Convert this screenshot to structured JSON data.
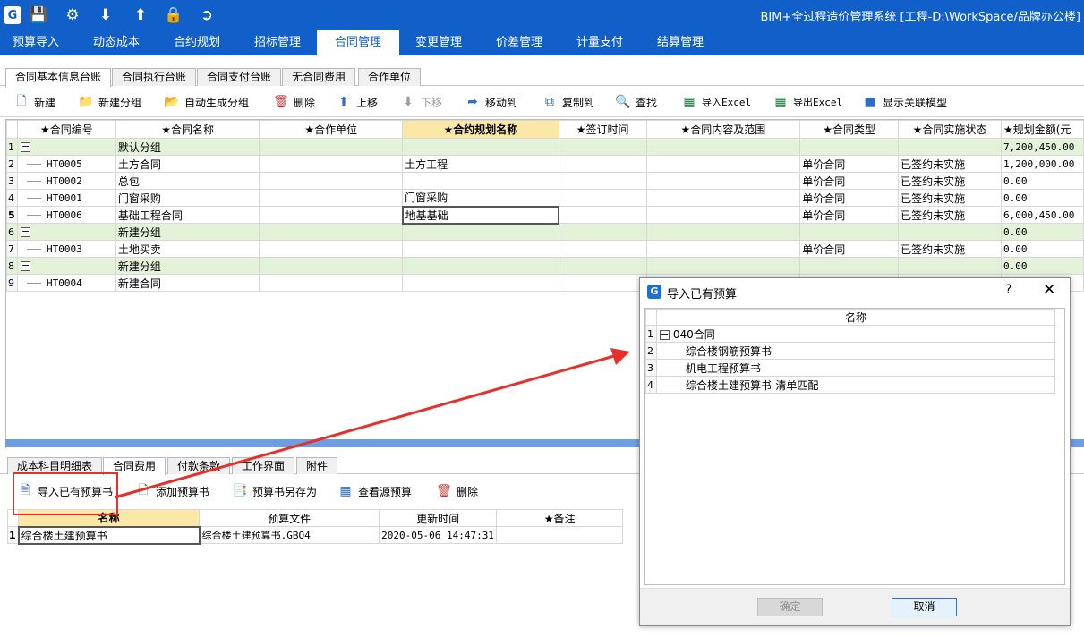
{
  "window": {
    "title": "BIM+全过程造价管理系统 [工程-D:\\WorkSpace/品牌办公楼]"
  },
  "quick_access": [
    "app-logo-icon",
    "save-icon",
    "settings-icon",
    "download-icon",
    "upload-icon",
    "lock-icon",
    "exit-icon"
  ],
  "menu": [
    "预算导入",
    "动态成本",
    "合约规划",
    "招标管理",
    "合同管理",
    "变更管理",
    "价差管理",
    "计量支付",
    "结算管理"
  ],
  "menu_active": "合同管理",
  "sub_tabs": [
    "合同基本信息台账",
    "合同执行台账",
    "合同支付台账",
    "无合同费用",
    "合作单位"
  ],
  "toolbar": {
    "new": "新建",
    "new_group": "新建分组",
    "auto_group": "自动生成分组",
    "delete": "删除",
    "move_up": "上移",
    "move_down": "下移",
    "move_to": "移动到",
    "copy_to": "复制到",
    "find": "查找",
    "import_excel": "导入Excel",
    "export_excel": "导出Excel",
    "show_model": "显示关联模型"
  },
  "grid": {
    "columns": [
      "★合同编号",
      "★合同名称",
      "★合作单位",
      "★合约规划名称",
      "★签订时间",
      "★合同内容及范围",
      "★合同类型",
      "★合同实施状态",
      "★规划金额(元"
    ],
    "rows": [
      {
        "n": "1",
        "type": "group",
        "toggle": "−",
        "name": "默认分组",
        "amount": "7,200,450.00"
      },
      {
        "n": "2",
        "code": "HT0005",
        "name": "土方合同",
        "plan": "土方工程",
        "ctype": "单价合同",
        "status": "已签约未实施",
        "amount": "1,200,000.00"
      },
      {
        "n": "3",
        "code": "HT0002",
        "name": "总包",
        "ctype": "单价合同",
        "status": "已签约未实施",
        "amount": "0.00"
      },
      {
        "n": "4",
        "code": "HT0001",
        "name": "门窗采购",
        "plan": "门窗采购",
        "ctype": "单价合同",
        "status": "已签约未实施",
        "amount": "0.00"
      },
      {
        "n": "5",
        "code": "HT0006",
        "name": "基础工程合同",
        "plan": "地基基础",
        "ctype": "单价合同",
        "status": "已签约未实施",
        "amount": "6,000,450.00"
      },
      {
        "n": "6",
        "type": "group",
        "toggle": "−",
        "name": "新建分组",
        "amount": "0.00"
      },
      {
        "n": "7",
        "code": "HT0003",
        "name": "土地买卖",
        "ctype": "单价合同",
        "status": "已签约未实施",
        "amount": "0.00"
      },
      {
        "n": "8",
        "type": "group",
        "toggle": "−",
        "name": "新建分组",
        "amount": "0.00"
      },
      {
        "n": "9",
        "code": "HT0004",
        "name": "新建合同"
      }
    ]
  },
  "bottom_tabs": [
    "成本科目明细表",
    "合同费用",
    "付款条款",
    "工作界面",
    "附件"
  ],
  "bottom_tabs_active": "合同费用",
  "bottom_toolbar": {
    "import_existing": "导入已有预算书",
    "add_budget": "添加预算书",
    "save_as": "预算书另存为",
    "view_source": "查看源预算",
    "delete": "删除"
  },
  "sub_grid": {
    "columns": [
      "名称",
      "预算文件",
      "更新时间",
      "★备注"
    ],
    "rows": [
      {
        "n": "1",
        "name": "综合楼土建预算书",
        "file": "综合楼土建预算书.GBQ4",
        "time": "2020-05-06 14:47:31",
        "note": ""
      }
    ]
  },
  "dialog": {
    "title": "导入已有预算",
    "help": "?",
    "close": "✕",
    "column": "名称",
    "rows": [
      {
        "n": "1",
        "toggle": "−",
        "name": "040合同",
        "type": "group"
      },
      {
        "n": "2",
        "name": "综合楼钢筋预算书"
      },
      {
        "n": "3",
        "name": "机电工程预算书"
      },
      {
        "n": "4",
        "name": "综合楼土建预算书-清单匹配"
      }
    ],
    "ok": "确定",
    "cancel": "取消"
  },
  "colors": {
    "titlebar": "#1160c9",
    "group_row": "#e4f2da",
    "selected_header": "#fbe8a6",
    "highlight": "#e8302b"
  }
}
